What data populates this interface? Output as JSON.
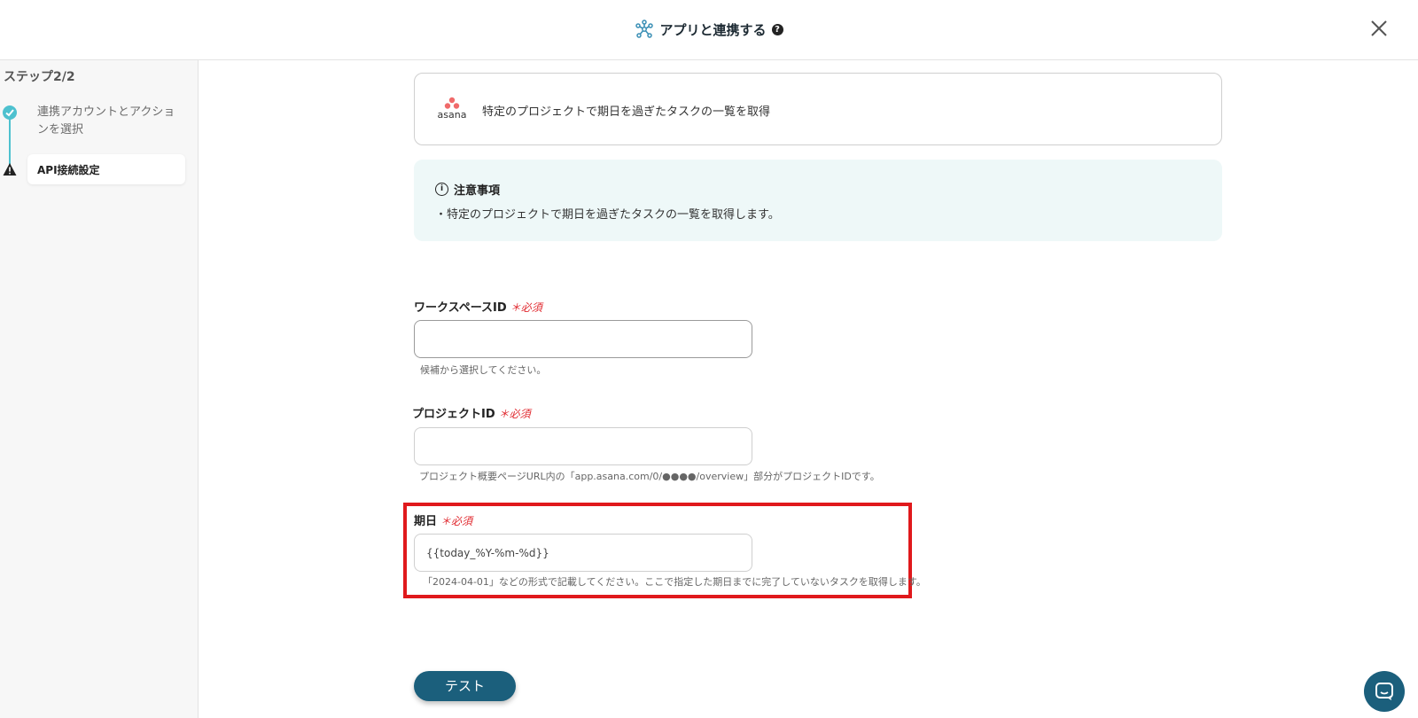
{
  "header": {
    "title": "アプリと連携する",
    "help_icon": "question-circle-icon"
  },
  "sidebar": {
    "step_title": "ステップ2/2",
    "steps": [
      {
        "label": "連携アカウントとアクションを選択",
        "status": "completed",
        "icon": "check-circle-icon"
      },
      {
        "label": "API接続設定",
        "status": "current-warning",
        "icon": "warning-icon"
      }
    ]
  },
  "app_card": {
    "app_name": "asana",
    "action": "特定のプロジェクトで期日を過ぎたタスクの一覧を取得"
  },
  "notice": {
    "title": "注意事項",
    "body": "・特定のプロジェクトで期日を過ぎたタスクの一覧を取得します。"
  },
  "form": {
    "fields": [
      {
        "label": "ワークスペースID",
        "required_mark": "＊必須",
        "value": "",
        "hint": "候補から選択してください。"
      },
      {
        "label": "プロジェクトID",
        "required_mark": "＊必須",
        "value": "",
        "hint": "プロジェクト概要ページURL内の「app.asana.com/0/●●●●/overview」部分がプロジェクトIDです。"
      },
      {
        "label": "期日",
        "required_mark": "＊必須",
        "value": "{{today_%Y-%m-%d}}",
        "hint": "「2024-04-01」などの形式で記載してください。ここで指定した期日までに完了していないタスクを取得します。"
      }
    ]
  },
  "actions": {
    "test_label": "テスト"
  },
  "colors": {
    "accent": "#1b5f7c",
    "step_teal": "#4ec1cf",
    "required_red": "#e0262c",
    "highlight_red": "#e0191c",
    "notice_bg": "#eef8f8"
  }
}
